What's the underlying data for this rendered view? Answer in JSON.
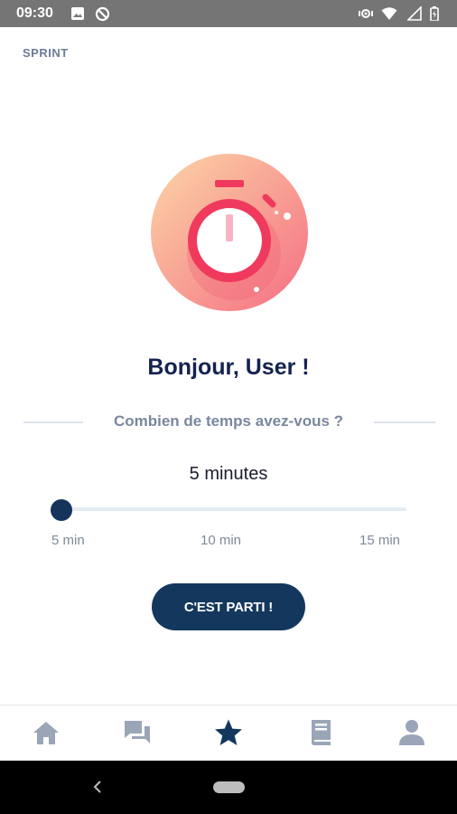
{
  "status_bar": {
    "time": "09:30",
    "icons": [
      "image-icon",
      "sync-off-icon",
      "vibrate-icon",
      "wifi-icon",
      "signal-icon",
      "battery-icon"
    ]
  },
  "header": {
    "title": "SPRINT"
  },
  "hero": {
    "icon": "stopwatch-icon"
  },
  "greeting": "Bonjour, User !",
  "prompt": {
    "question": "Combien de temps avez-vous ?"
  },
  "duration": {
    "selected_label": "5 minutes",
    "min": 5,
    "max": 15,
    "value": 5,
    "ticks": [
      "5 min",
      "10 min",
      "15 min"
    ]
  },
  "start_button": {
    "label": "C'EST PARTI !"
  },
  "bottom_nav": {
    "items": [
      {
        "icon": "home-icon",
        "active": false
      },
      {
        "icon": "chat-icon",
        "active": false
      },
      {
        "icon": "star-icon",
        "active": true
      },
      {
        "icon": "book-icon",
        "active": false
      },
      {
        "icon": "profile-icon",
        "active": false
      }
    ],
    "active_color": "#14375e",
    "inactive_color": "#9aa5b8"
  },
  "colors": {
    "accent": "#14375e",
    "title_text": "#152250",
    "hero_red": "#ef3a5d"
  }
}
